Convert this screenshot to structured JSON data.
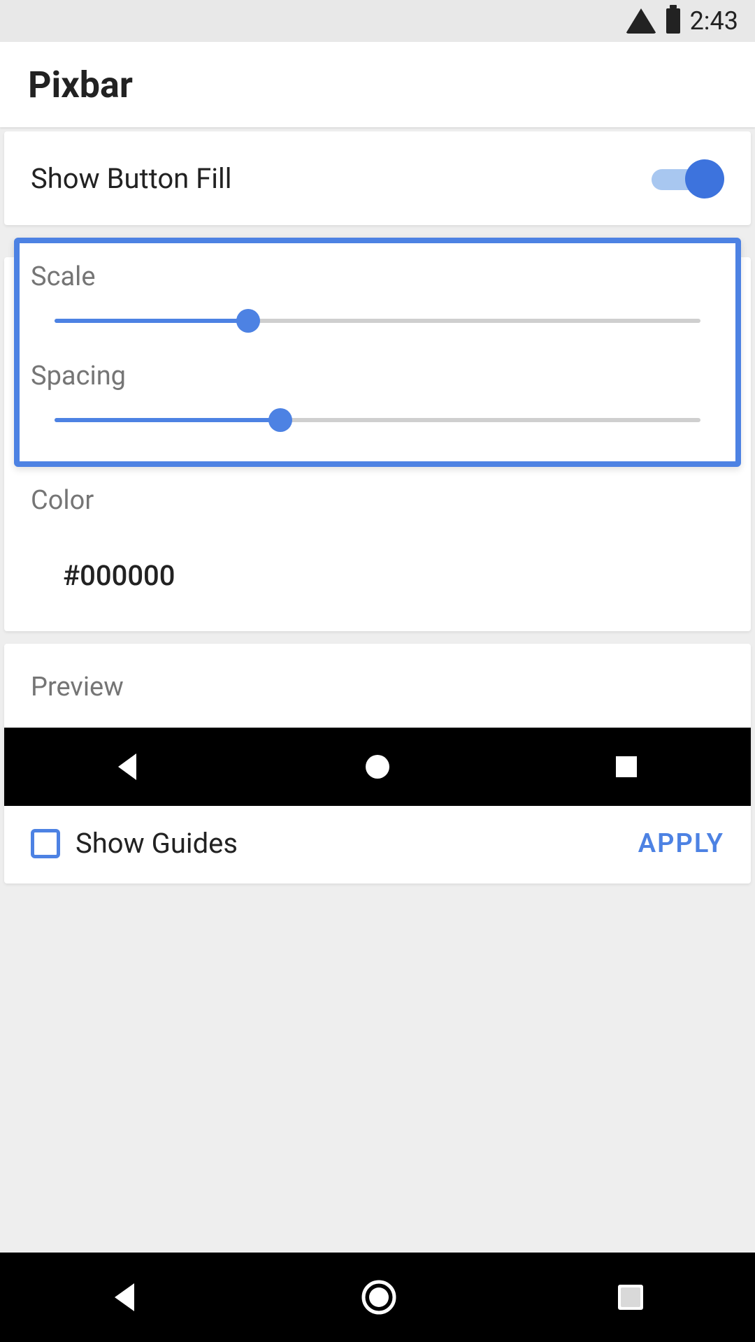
{
  "status": {
    "time": "2:43"
  },
  "app": {
    "title": "Pixbar"
  },
  "settings": {
    "show_button_fill_label": "Show Button Fill",
    "show_button_fill_on": true,
    "scale": {
      "label": "Scale",
      "percent": 30
    },
    "spacing": {
      "label": "Spacing",
      "percent": 35
    },
    "color": {
      "label": "Color",
      "value": "#000000"
    }
  },
  "preview": {
    "label": "Preview",
    "show_guides_label": "Show Guides",
    "show_guides_checked": false,
    "apply_label": "APPLY"
  }
}
